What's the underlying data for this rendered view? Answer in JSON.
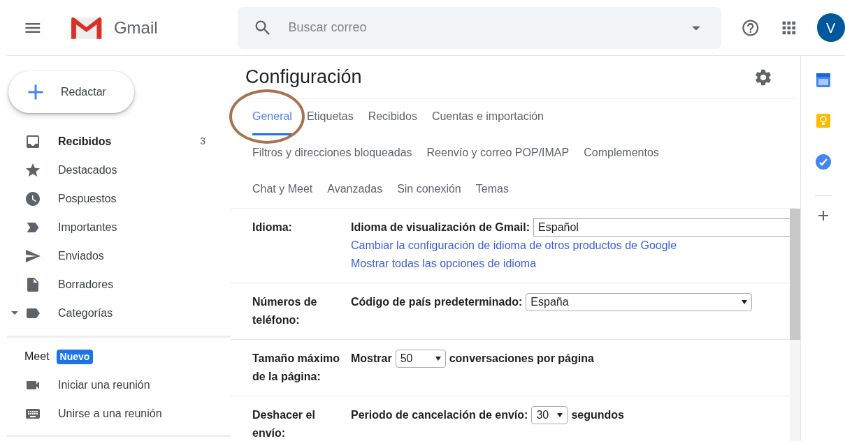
{
  "header": {
    "app_name": "Gmail",
    "search": {
      "placeholder": "Buscar correo"
    },
    "avatar": "V"
  },
  "sidebar": {
    "compose": "Redactar",
    "items": [
      {
        "kind": "inbox",
        "label": "Recibidos",
        "count": "3",
        "unread": true,
        "collapsible": false
      },
      {
        "kind": "star",
        "label": "Destacados",
        "unread": false,
        "collapsible": false
      },
      {
        "kind": "clock",
        "label": "Pospuestos",
        "unread": false,
        "collapsible": false
      },
      {
        "kind": "important",
        "label": "Importantes",
        "unread": false,
        "collapsible": false
      },
      {
        "kind": "send",
        "label": "Enviados",
        "unread": false,
        "collapsible": false
      },
      {
        "kind": "draft",
        "label": "Borradores",
        "unread": false,
        "collapsible": false
      },
      {
        "kind": "label",
        "label": "Categorías",
        "unread": false,
        "collapsible": true
      }
    ],
    "meet": {
      "title": "Meet",
      "badge": "Nuevo",
      "items": [
        {
          "kind": "video",
          "label": "Iniciar una reunión"
        },
        {
          "kind": "keyboard",
          "label": "Unirse a una reunión"
        }
      ]
    }
  },
  "settings": {
    "title": "Configuración",
    "tab_rows": [
      [
        {
          "label": "General",
          "selected": true
        },
        {
          "label": "Etiquetas",
          "selected": false
        },
        {
          "label": "Recibidos",
          "selected": false
        },
        {
          "label": "Cuentas e importación",
          "selected": false
        }
      ],
      [
        {
          "label": "Filtros y direcciones bloqueadas",
          "selected": false
        },
        {
          "label": "Reenvío y correo POP/IMAP",
          "selected": false
        },
        {
          "label": "Complementos",
          "selected": false
        }
      ],
      [
        {
          "label": "Chat y Meet",
          "selected": false
        },
        {
          "label": "Avanzadas",
          "selected": false
        },
        {
          "label": "Sin conexión",
          "selected": false
        },
        {
          "label": "Temas",
          "selected": false
        }
      ]
    ],
    "rows": [
      {
        "label": "Idioma:",
        "lines": [
          [
            {
              "kind": "text",
              "text": "Idioma de visualización de Gmail:"
            },
            {
              "kind": "input",
              "value": "Español"
            }
          ],
          [
            {
              "kind": "link",
              "text": "Cambiar la configuración de idioma de otros productos de Google"
            }
          ],
          [
            {
              "kind": "link",
              "text": "Mostrar todas las opciones de idioma"
            }
          ]
        ]
      },
      {
        "label": "Números de teléfono:",
        "lines": [
          [
            {
              "kind": "text",
              "text": "Código de país predeterminado:"
            },
            {
              "kind": "select",
              "value": "España"
            }
          ]
        ]
      },
      {
        "label": "Tamaño máximo de la página:",
        "lines": [
          [
            {
              "kind": "text",
              "text": "Mostrar"
            },
            {
              "kind": "select",
              "value": "50"
            },
            {
              "kind": "text",
              "text": "conversaciones por página"
            }
          ]
        ]
      },
      {
        "label": "Deshacer el envío:",
        "lines": [
          [
            {
              "kind": "text",
              "text": "Periodo de cancelación de envío:"
            },
            {
              "kind": "select",
              "value": "30"
            },
            {
              "kind": "text",
              "text": "segundos"
            }
          ]
        ]
      }
    ]
  }
}
